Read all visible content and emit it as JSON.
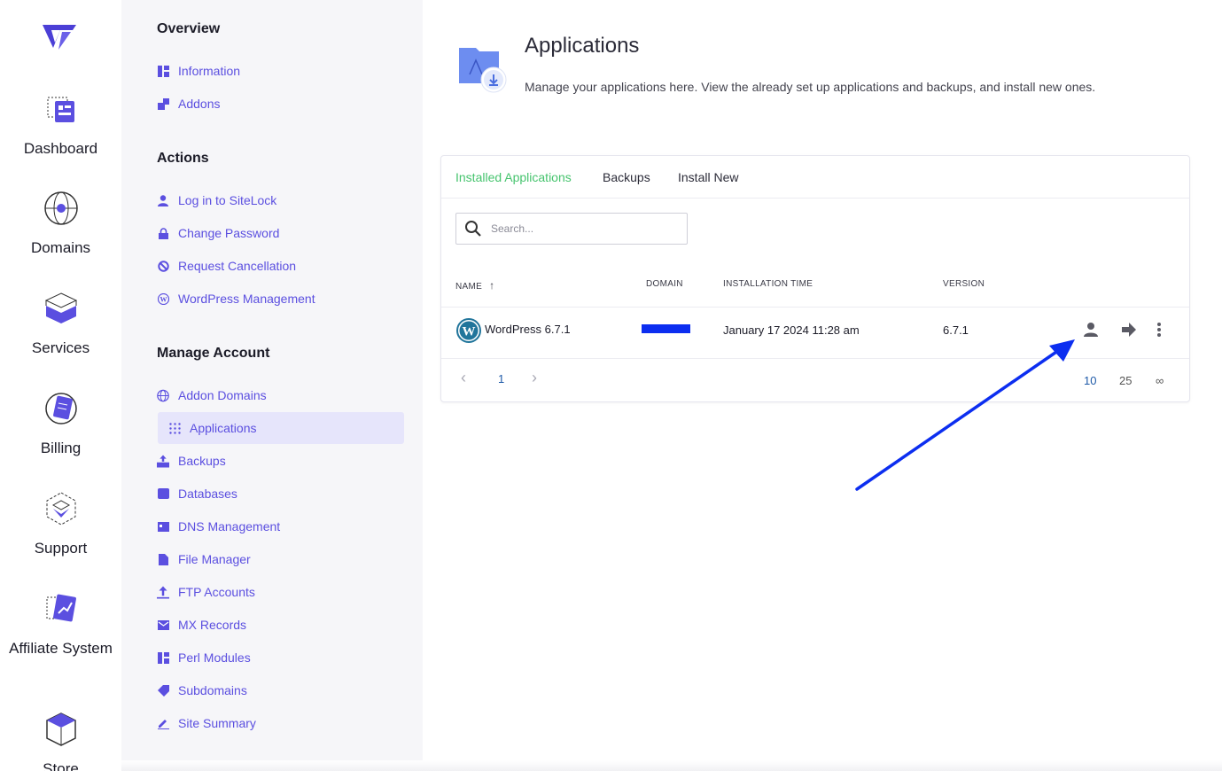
{
  "rail": {
    "items": [
      {
        "label": "Dashboard",
        "icon": "dashboard-icon"
      },
      {
        "label": "Domains",
        "icon": "globe-icon"
      },
      {
        "label": "Services",
        "icon": "box-stack-icon"
      },
      {
        "label": "Billing",
        "icon": "billing-icon"
      },
      {
        "label": "Support",
        "icon": "support-icon"
      },
      {
        "label": "Affiliate System",
        "icon": "affiliate-icon"
      },
      {
        "label": "Store",
        "icon": "store-icon"
      }
    ]
  },
  "subnav": {
    "overview": {
      "heading": "Overview",
      "items": [
        {
          "label": "Information",
          "icon": "dashboard-grid-icon"
        },
        {
          "label": "Addons",
          "icon": "addons-icon"
        }
      ]
    },
    "actions": {
      "heading": "Actions",
      "items": [
        {
          "label": "Log in to SiteLock",
          "icon": "user-icon"
        },
        {
          "label": "Change Password",
          "icon": "lock-icon"
        },
        {
          "label": "Request Cancellation",
          "icon": "ban-icon"
        },
        {
          "label": "WordPress Management",
          "icon": "wordpress-icon"
        }
      ]
    },
    "manage": {
      "heading": "Manage Account",
      "items": [
        {
          "label": "Addon Domains",
          "icon": "globe-icon"
        },
        {
          "label": "Applications",
          "icon": "apps-grid-icon",
          "active": true
        },
        {
          "label": "Backups",
          "icon": "backup-icon"
        },
        {
          "label": "Databases",
          "icon": "database-icon"
        },
        {
          "label": "DNS Management",
          "icon": "dns-icon"
        },
        {
          "label": "File Manager",
          "icon": "file-icon"
        },
        {
          "label": "FTP Accounts",
          "icon": "upload-icon"
        },
        {
          "label": "MX Records",
          "icon": "mail-icon"
        },
        {
          "label": "Perl Modules",
          "icon": "module-icon"
        },
        {
          "label": "Subdomains",
          "icon": "tag-icon"
        },
        {
          "label": "Site Summary",
          "icon": "pencil-icon"
        }
      ]
    }
  },
  "main": {
    "title": "Applications",
    "description": "Manage your applications here. View the already set up applications and backups, and install new ones.",
    "tabs": [
      {
        "label": "Installed Applications",
        "active": true
      },
      {
        "label": "Backups"
      },
      {
        "label": "Install New"
      }
    ],
    "search": {
      "placeholder": "Search..."
    },
    "table": {
      "columns": [
        "NAME",
        "DOMAIN",
        "INSTALLATION TIME",
        "VERSION"
      ],
      "sort_indicator": "↑",
      "rows": [
        {
          "name": "WordPress 6.7.1",
          "domain": "",
          "installed": "January 17 2024 11:28 am",
          "version": "6.7.1"
        }
      ]
    },
    "pagination": {
      "prev": "‹",
      "page": "1",
      "next": "›",
      "per_page": [
        "10",
        "25",
        "∞"
      ],
      "per_page_selected": "10"
    }
  },
  "colors": {
    "accent": "#5b4fe0",
    "active_tab": "#46c46e",
    "annotation_arrow": "#0c2ef0"
  }
}
